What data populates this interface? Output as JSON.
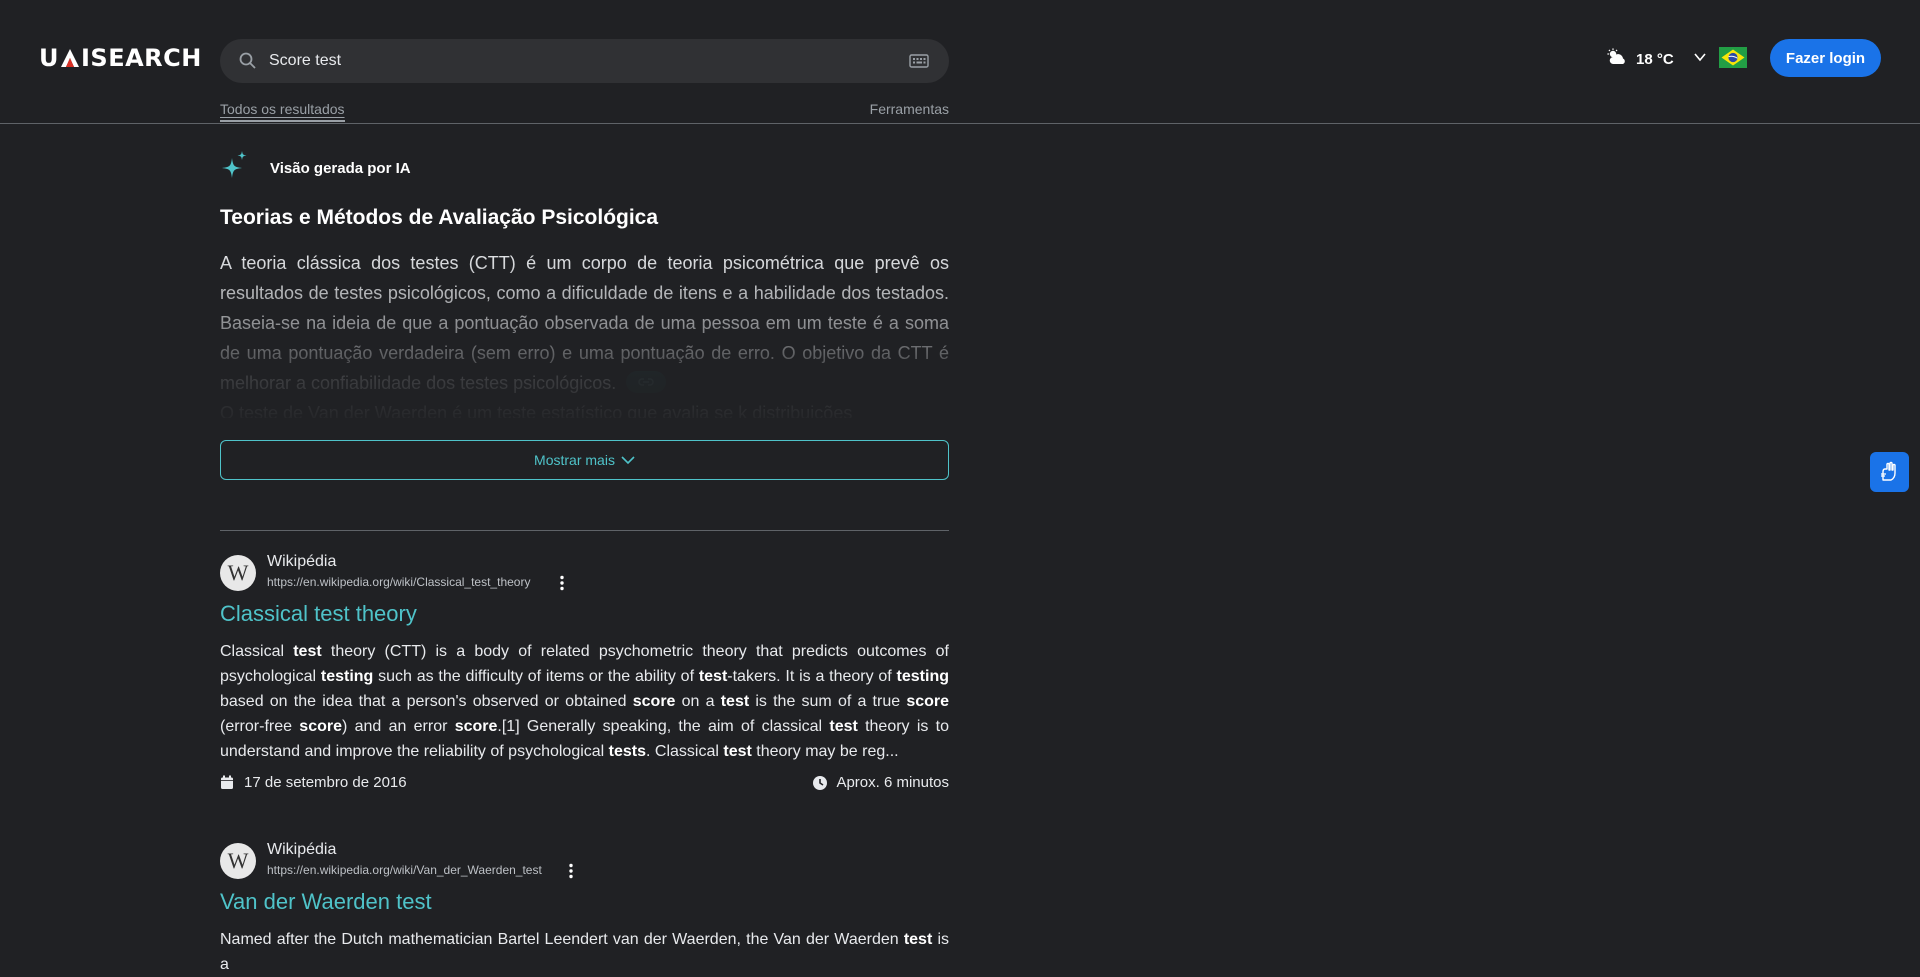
{
  "header": {
    "logo_text_left": "U",
    "logo_text_right": "ISEARCH",
    "search_value": "Score test",
    "weather_temp": "18 °C",
    "login_label": "Fazer login"
  },
  "tabs": {
    "all_results": "Todos os resultados",
    "tools": "Ferramentas"
  },
  "ai_overview": {
    "label": "Visão gerada por IA",
    "title": "Teorias e Métodos de Avaliação Psicológica",
    "paragraph1": "A teoria clássica dos testes (CTT) é um corpo de teoria psicométrica que prevê os resultados de testes psicológicos, como a dificuldade de itens e a habilidade dos testados. Baseia-se na ideia de que a pontuação observada de uma pessoa em um teste é a soma de uma pontuação verdadeira (sem erro) e uma pontuação de erro. O objetivo da CTT é melhorar a confiabilidade dos testes psicológicos.",
    "paragraph2": "O teste de Van der Waerden é um teste estatístico que avalia se k distribuições",
    "show_more": "Mostrar mais"
  },
  "results": [
    {
      "site": "Wikipédia",
      "url": "https://en.wikipedia.org/wiki/Classical_test_theory",
      "title": "Classical test theory",
      "date": "17 de setembro de 2016",
      "read_time": "Aprox. 6 minutos"
    },
    {
      "site": "Wikipédia",
      "url": "https://en.wikipedia.org/wiki/Van_der_Waerden_test",
      "title": "Van der Waerden test"
    }
  ],
  "snippet1": {
    "s1": "Classical ",
    "b1": "test",
    "s2": " theory (CTT) is a body of related psychometric theory that predicts outcomes of psychological ",
    "b2": "testing",
    "s3": " such as the difficulty of items or the ability of ",
    "b3": "test",
    "s4": "-takers. It is a theory of ",
    "b4": "testing",
    "s5": " based on the idea that a person's observed or obtained ",
    "b5": "score",
    "s6": " on a ",
    "b6": "test",
    "s7": " is the sum of a true ",
    "b7": "score",
    "s8": " (error-free ",
    "b8": "score",
    "s9": ") and an error ",
    "b9": "score",
    "s10": ".[1] Generally speaking, the aim of classical ",
    "b10": "test",
    "s11": " theory is to understand and improve the reliability of psychological ",
    "b11": "tests",
    "s12": ". Classical ",
    "b12": "test",
    "s13": " theory may be reg..."
  },
  "snippet2": {
    "s1": "Named after the Dutch mathematician Bartel Leendert van der Waerden, the Van der Waerden ",
    "b1": "test",
    "s2": " is a"
  },
  "colors": {
    "background": "#202124",
    "accent_teal": "#4fc3c9",
    "button_blue": "#1a73e8"
  },
  "icons": [
    "search-icon",
    "keyboard-icon",
    "weather-cloud-sun-icon",
    "chevron-down-icon",
    "brazil-flag-icon",
    "sparkle-icon",
    "link-icon",
    "wikipedia-icon",
    "more-vert-icon",
    "calendar-icon",
    "clock-icon",
    "sign-language-icon"
  ]
}
